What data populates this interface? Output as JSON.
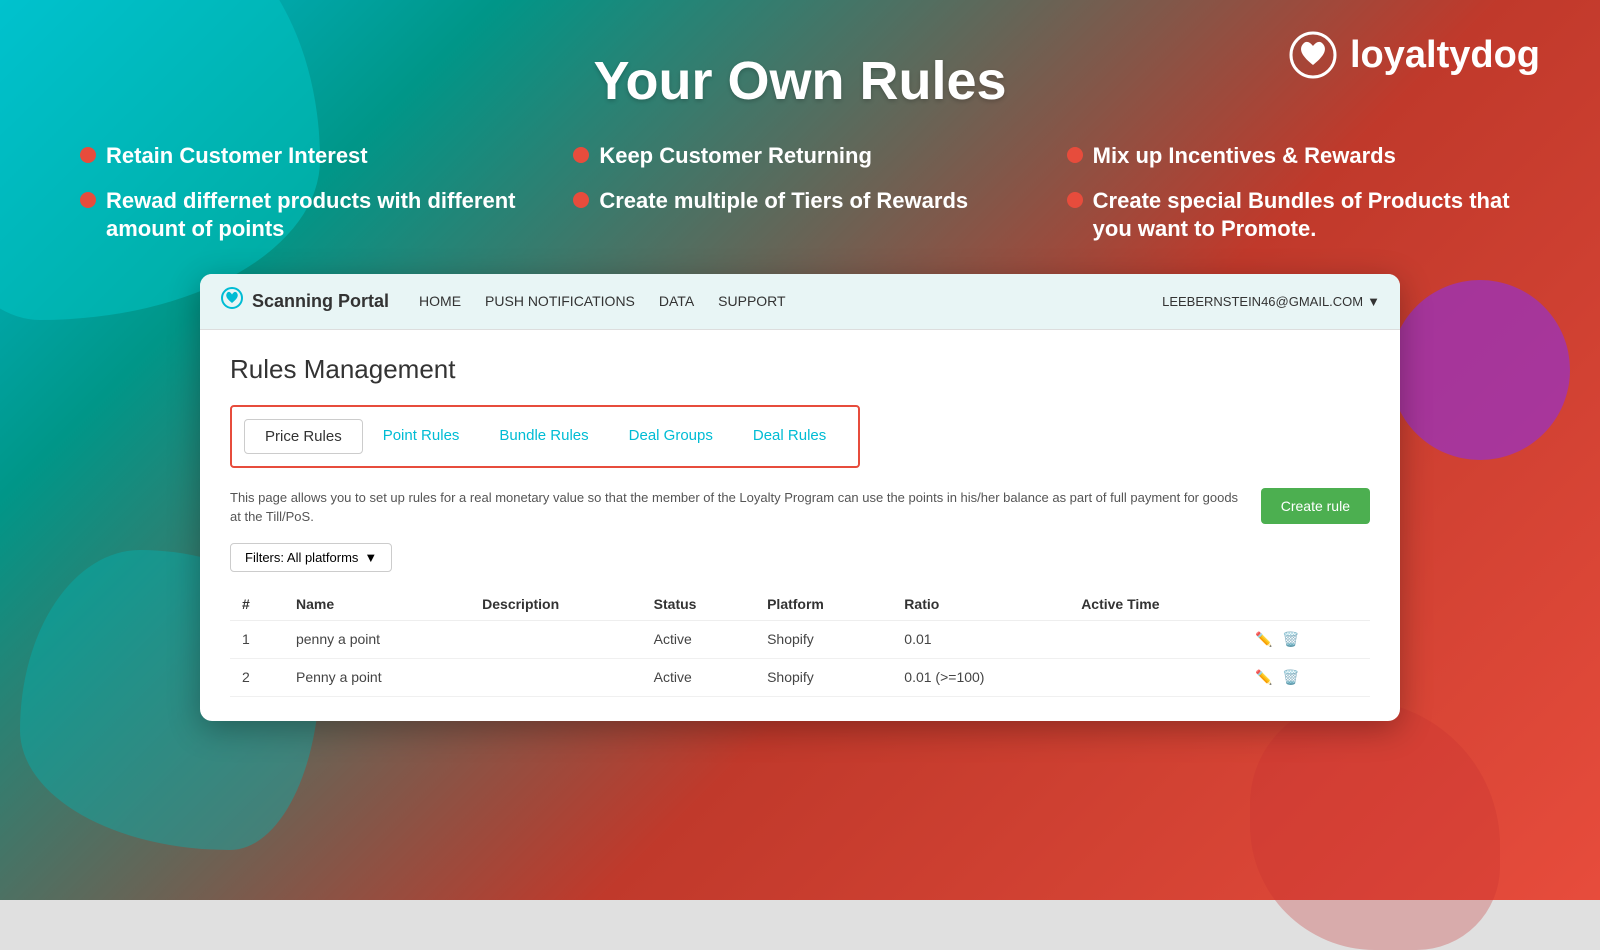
{
  "background": {
    "gradient": "teal-to-red"
  },
  "logo": {
    "icon": "❤",
    "text": "loyaltydog"
  },
  "main_title": "Your Own Rules",
  "features": [
    {
      "id": "f1",
      "text": "Retain Customer Interest"
    },
    {
      "id": "f2",
      "text": "Keep Customer Returning"
    },
    {
      "id": "f3",
      "text": "Mix up Incentives & Rewards"
    },
    {
      "id": "f4",
      "text": "Rewad differnet products with different amount of points"
    },
    {
      "id": "f5",
      "text": "Create multiple of Tiers of Rewards"
    },
    {
      "id": "f6",
      "text": "Create special Bundles of Products that you want to Promote."
    }
  ],
  "portal": {
    "brand": "Scanning Portal",
    "nav": {
      "home": "HOME",
      "push_notifications": "PUSH NOTIFICATIONS",
      "data": "DATA",
      "support": "SUPPORT",
      "user_email": "LEEBERNSTEIN46@GMAIL.COM"
    },
    "page_title": "Rules Management",
    "tabs": [
      {
        "id": "price-rules",
        "label": "Price Rules",
        "active": true
      },
      {
        "id": "point-rules",
        "label": "Point Rules",
        "active": false
      },
      {
        "id": "bundle-rules",
        "label": "Bundle Rules",
        "active": false
      },
      {
        "id": "deal-groups",
        "label": "Deal Groups",
        "active": false
      },
      {
        "id": "deal-rules",
        "label": "Deal Rules",
        "active": false
      }
    ],
    "description": "This page allows you to set up rules for a real monetary value so that the member of the Loyalty Program can use the points in his/her balance as part of full payment for goods at the Till/PoS.",
    "create_rule_label": "Create rule",
    "filter_label": "Filters: All platforms",
    "table": {
      "headers": [
        "#",
        "Name",
        "Description",
        "Status",
        "Platform",
        "Ratio",
        "Active Time"
      ],
      "rows": [
        {
          "num": "1",
          "name": "penny a point",
          "description": "",
          "status": "Active",
          "platform": "Shopify",
          "ratio": "0.01",
          "active_time": ""
        },
        {
          "num": "2",
          "name": "Penny a point",
          "description": "",
          "status": "Active",
          "platform": "Shopify",
          "ratio": "0.01 (>=100)",
          "active_time": ""
        }
      ]
    }
  }
}
